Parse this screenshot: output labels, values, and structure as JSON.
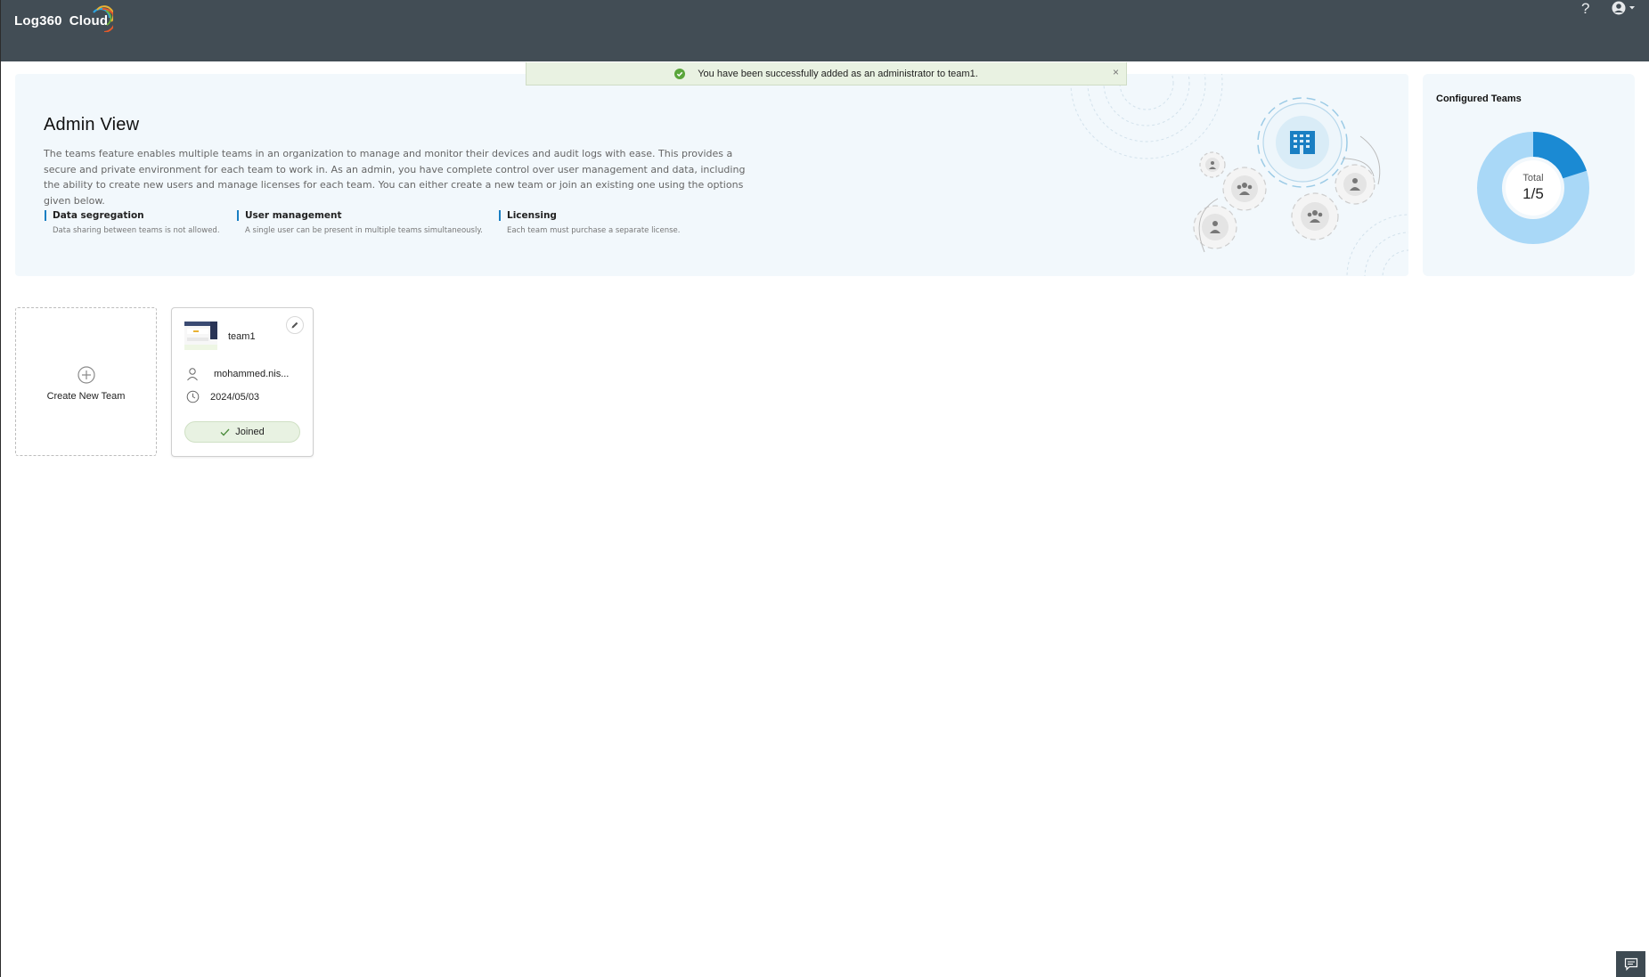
{
  "app": {
    "name": "Log360",
    "name_suffix": "Cloud"
  },
  "header": {
    "help_label": "?",
    "icons": [
      "help-icon",
      "user-avatar-icon",
      "caret-down-icon"
    ]
  },
  "toast": {
    "message": "You have been successfully added as an administrator to team1.",
    "close_label": "×",
    "status_color": "#5aa63b"
  },
  "admin_view": {
    "title": "Admin View",
    "description": "The teams feature enables multiple teams in an organization to manage and monitor their devices and audit logs with ease. This provides a secure and private environment for each team to work in. As an admin, you have complete control over user management and data, including the ability to create new users and manage licenses for each team. You can either create a new team or join an existing one using the options given below.",
    "features": [
      {
        "title": "Data segregation",
        "detail": "Data sharing between teams is not allowed."
      },
      {
        "title": "User management",
        "detail": "A single user can be present in multiple teams simultaneously."
      },
      {
        "title": "Licensing",
        "detail": "Each team must purchase a separate license."
      }
    ]
  },
  "configured_teams": {
    "title": "Configured Teams",
    "total_label": "Total",
    "value_text": "1/5",
    "used": 1,
    "limit": 5,
    "colors": {
      "used": "#1b8ad3",
      "remaining": "#a9d8f7"
    }
  },
  "create_team": {
    "label": "Create New Team"
  },
  "teams": [
    {
      "name": "team1",
      "owner": "mohammed.nis...",
      "date": "2024/05/03",
      "status": "Joined"
    }
  ],
  "chat": {
    "icon": "chat-icon"
  }
}
